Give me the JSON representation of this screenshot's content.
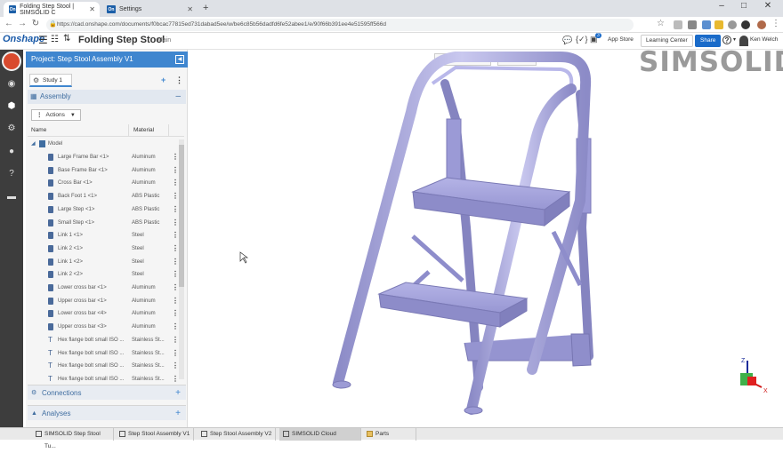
{
  "browser": {
    "tabs": [
      {
        "label": "Folding Step Stool | SIMSOLID C",
        "favicon": "On",
        "active": true
      },
      {
        "label": "Settings",
        "favicon": "On",
        "active": false
      }
    ],
    "new_tab": "+",
    "url": "https://cad.onshape.com/documents/f0bcac77815ed731dabad5ee/w/be6c85b56dadfd6fe52abee1/e/90f66b391ee4e51595ff566d",
    "window_controls": [
      "–",
      "□",
      "✕"
    ]
  },
  "header": {
    "logo": "Onshape",
    "doc_title": "Folding Step Stool",
    "workspace": "Main",
    "notification_count": "3",
    "app_store": "App Store",
    "learning_center": "Learning Center",
    "share": "Share",
    "help": "?",
    "user": "Ken Welch"
  },
  "panel": {
    "project_title": "Project: Step Stool Assembly V1",
    "study_tab": "Study 1",
    "assembly_label": "Assembly",
    "actions_label": "Actions",
    "col_name": "Name",
    "col_material": "Material",
    "model_label": "Model",
    "parts": [
      {
        "name": "Large Frame Bar <1>",
        "material": "Aluminum"
      },
      {
        "name": "Base Frame Bar <1>",
        "material": "Aluminum"
      },
      {
        "name": "Cross Bar <1>",
        "material": "Aluminum"
      },
      {
        "name": "Back Foot 1 <1>",
        "material": "ABS Plastic"
      },
      {
        "name": "Large Step <1>",
        "material": "ABS Plastic"
      },
      {
        "name": "Small Step <1>",
        "material": "ABS Plastic"
      },
      {
        "name": "Link 1 <1>",
        "material": "Steel"
      },
      {
        "name": "Link 2 <1>",
        "material": "Steel"
      },
      {
        "name": "Link 1 <2>",
        "material": "Steel"
      },
      {
        "name": "Link 2 <2>",
        "material": "Steel"
      },
      {
        "name": "Lower cross bar <1>",
        "material": "Aluminum"
      },
      {
        "name": "Upper cross bar <1>",
        "material": "Aluminum"
      },
      {
        "name": "Lower cross bar <4>",
        "material": "Aluminum"
      },
      {
        "name": "Upper cross bar <3>",
        "material": "Aluminum"
      },
      {
        "name": "Hex flange bolt small ISO ...",
        "material": "Stainless St..."
      },
      {
        "name": "Hex flange bolt small ISO ...",
        "material": "Stainless St..."
      },
      {
        "name": "Hex flange bolt small ISO ...",
        "material": "Stainless St..."
      },
      {
        "name": "Hex flange bolt small ISO ...",
        "material": "Stainless St..."
      }
    ],
    "connections_label": "Connections",
    "analyses_label": "Analyses"
  },
  "viewport": {
    "display_options": "Display options",
    "views": "Views",
    "brand": "SIMSOLID",
    "model_color": "#a9a8dc",
    "axis_x": "X",
    "axis_z": "Z"
  },
  "taskbar": {
    "tabs": [
      {
        "label": "SIMSOLID Step Stool Tu...",
        "active": false
      },
      {
        "label": "Step Stool Assembly V1",
        "active": false
      },
      {
        "label": "Step Stool Assembly V2",
        "active": false
      },
      {
        "label": "SIMSOLID Cloud",
        "active": true
      },
      {
        "label": "Parts",
        "active": false
      }
    ]
  }
}
